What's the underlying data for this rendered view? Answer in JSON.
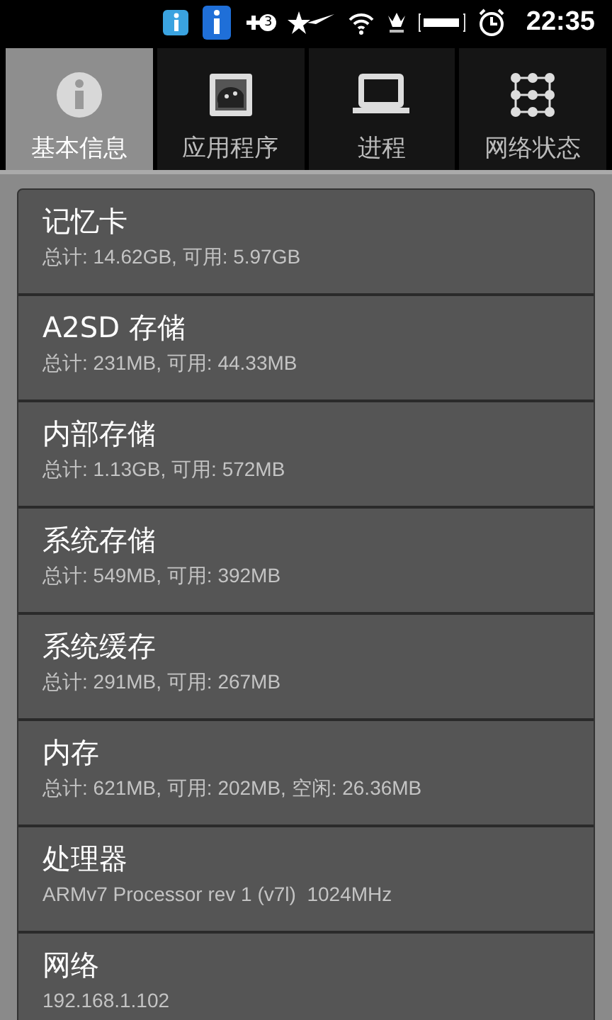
{
  "status_bar": {
    "notification_count": "3",
    "time": "22:35"
  },
  "tabs": [
    {
      "label": "基本信息",
      "kind": "info",
      "selected": true
    },
    {
      "label": "应用程序",
      "kind": "app",
      "selected": false
    },
    {
      "label": "进程",
      "kind": "laptop",
      "selected": false
    },
    {
      "label": "网络状态",
      "kind": "grid",
      "selected": false
    }
  ],
  "items": [
    {
      "title": "记忆卡",
      "detail": "总计: 14.62GB, 可用: 5.97GB"
    },
    {
      "title": "A2SD 存储",
      "detail": "总计: 231MB, 可用: 44.33MB"
    },
    {
      "title": "内部存储",
      "detail": "总计: 1.13GB, 可用: 572MB"
    },
    {
      "title": "系统存储",
      "detail": "总计: 549MB, 可用: 392MB"
    },
    {
      "title": "系统缓存",
      "detail": "总计: 291MB, 可用: 267MB"
    },
    {
      "title": "内存",
      "detail": "总计: 621MB, 可用: 202MB, 空闲: 26.36MB"
    },
    {
      "title": "处理器",
      "detail": "ARMv7 Processor rev 1 (v7l)  1024MHz"
    },
    {
      "title": "网络",
      "detail": "192.168.1.102"
    }
  ]
}
